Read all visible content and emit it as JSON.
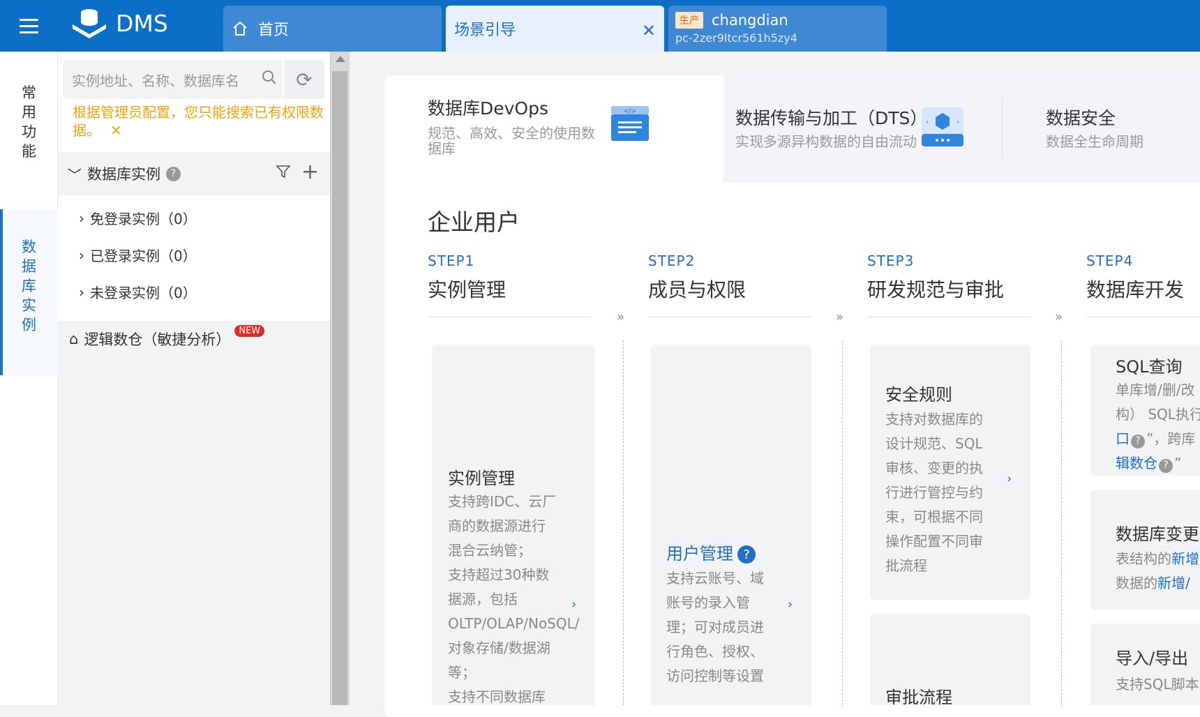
{
  "app": {
    "name": "DMS"
  },
  "tabs": {
    "home": {
      "label": "首页"
    },
    "guide": {
      "label": "场景引导"
    },
    "instance": {
      "tag": "生产",
      "name": "changdian",
      "id": "pc-2zer9ltcr561h5zy4"
    }
  },
  "leftnav": {
    "common": [
      "常",
      "用",
      "功",
      "能"
    ],
    "db": [
      "数",
      "据",
      "库",
      "实",
      "例"
    ]
  },
  "panel": {
    "search_placeholder": "实例地址、名称、数据库名",
    "notice": "根据管理员配置，您只能搜索已有权限数据。",
    "tree_title": "数据库实例",
    "items": [
      "免登录实例（0）",
      "已登录实例（0）",
      "未登录实例（0）"
    ],
    "logic_label": "逻辑数仓（敏捷分析）",
    "new_badge": "NEW"
  },
  "categories": [
    {
      "title": "数据库DevOps",
      "sub": "规范、高效、安全的使用数据库"
    },
    {
      "title": "数据传输与加工（DTS）",
      "sub": "实现多源异构数据的自由流动"
    },
    {
      "title": "数据安全",
      "sub": "数据全生命周期"
    }
  ],
  "enterprise": {
    "title": "企业用户",
    "steps": [
      {
        "label": "STEP1",
        "title": "实例管理"
      },
      {
        "label": "STEP2",
        "title": "成员与权限"
      },
      {
        "label": "STEP3",
        "title": "研发规范与审批"
      },
      {
        "label": "STEP4",
        "title": "数据库开发"
      }
    ]
  },
  "cards": {
    "instance_mgmt": {
      "title": "实例管理",
      "desc": [
        "支持跨IDC、云厂",
        "商的数据源进行",
        "混合云纳管；",
        "支持超过30种数",
        "据源，包括",
        "OLTP/OLAP/NoSQL/",
        "对象存储/数据湖",
        "等；",
        "支持不同数据库"
      ]
    },
    "user_mgmt": {
      "title": "用户管理",
      "desc": [
        "支持云账号、域",
        "账号的录入管",
        "理；可对成员进",
        "行角色、授权、",
        "访问控制等设置"
      ]
    },
    "security_rules": {
      "title": "安全规则",
      "desc": [
        "支持对数据库的",
        "设计规范、SQL",
        "审核、变更的执",
        "行进行管控与约",
        "束，可根据不同",
        "操作配置不同审",
        "批流程"
      ]
    },
    "approval": {
      "title": "审批流程"
    },
    "sql_query": {
      "title": "SQL查询",
      "l1": "单库增/删/改",
      "l2": "构） SQL执行",
      "l3a": "口",
      "l3b": "”，跨库",
      "l4a": "辑数仓",
      "l4b": "”"
    },
    "db_change": {
      "title": "数据库变更",
      "l1a": "表结构的",
      "l1b": "新增",
      "l2a": "数据的",
      "l2b": "新增/"
    },
    "import_export": {
      "title": "导入/导出",
      "l1": "支持SQL脚本"
    }
  },
  "colors": {
    "topbar": "#0b6fc7",
    "accent": "#1f6fc4",
    "warning": "#f0a20c"
  }
}
